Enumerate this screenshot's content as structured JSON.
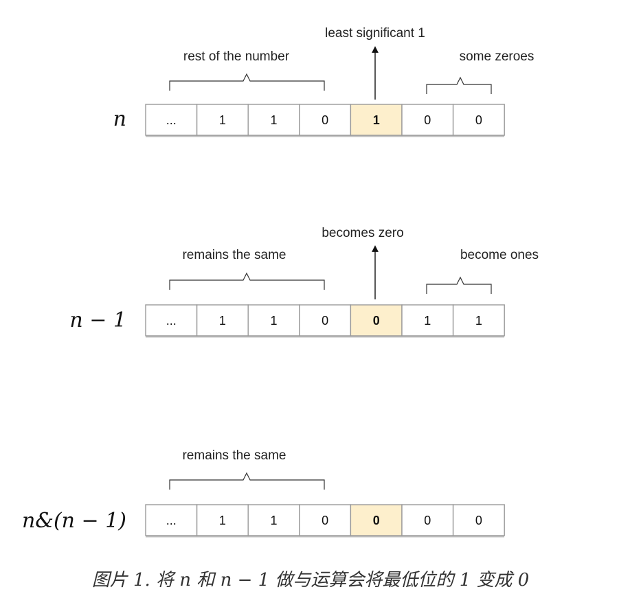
{
  "rows": [
    {
      "label": "n",
      "cells": [
        "...",
        "1",
        "1",
        "0",
        "1",
        "0",
        "0"
      ],
      "highlight_index": 4,
      "annotations": {
        "left": "rest of the number",
        "arrow": "least significant 1",
        "right": "some zeroes"
      }
    },
    {
      "label": "n − 1",
      "cells": [
        "...",
        "1",
        "1",
        "0",
        "0",
        "1",
        "1"
      ],
      "highlight_index": 4,
      "annotations": {
        "left": "remains the same",
        "arrow": "becomes zero",
        "right": "become ones"
      }
    },
    {
      "label": "n&(n − 1)",
      "cells": [
        "...",
        "1",
        "1",
        "0",
        "0",
        "0",
        "0"
      ],
      "highlight_index": 4,
      "annotations": {
        "left": "remains the same"
      }
    }
  ],
  "caption": "图片 1. 将 n 和 n − 1 做与运算会将最低位的 1 变成 0",
  "colors": {
    "highlight": "#fdefcc",
    "cell_border": "#9a9a9a"
  }
}
